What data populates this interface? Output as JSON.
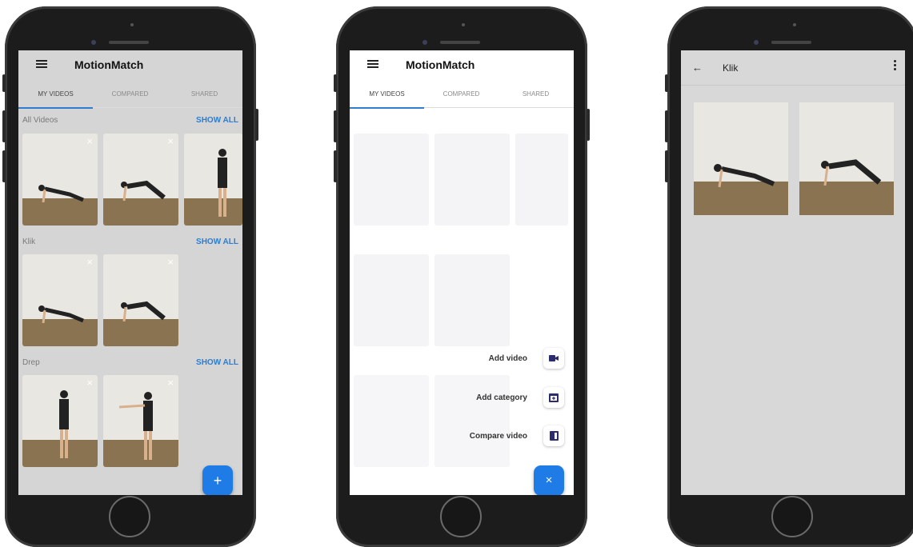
{
  "colors": {
    "accent": "#2e7dd1",
    "fab": "#1f7be6",
    "action_icon": "#2b2b6e"
  },
  "phone1": {
    "app_title": "MotionMatch",
    "tabs": [
      "MY VIDEOS",
      "COMPARED",
      "SHARED"
    ],
    "sections": [
      {
        "title": "All Videos",
        "show_all": "SHOW ALL"
      },
      {
        "title": "Klik",
        "show_all": "SHOW ALL"
      },
      {
        "title": "Drep",
        "show_all": "SHOW ALL"
      }
    ],
    "close_glyph": "×",
    "fab_glyph": "+"
  },
  "phone2": {
    "app_title": "MotionMatch",
    "tabs": [
      "MY VIDEOS",
      "COMPARED",
      "SHARED"
    ],
    "actions": [
      {
        "label": "Add video",
        "icon": "video-plus-icon"
      },
      {
        "label": "Add category",
        "icon": "folder-plus-icon"
      },
      {
        "label": "Compare video",
        "icon": "compare-icon"
      }
    ],
    "fab_glyph": "×"
  },
  "phone3": {
    "title": "Klik",
    "back_glyph": "←"
  }
}
